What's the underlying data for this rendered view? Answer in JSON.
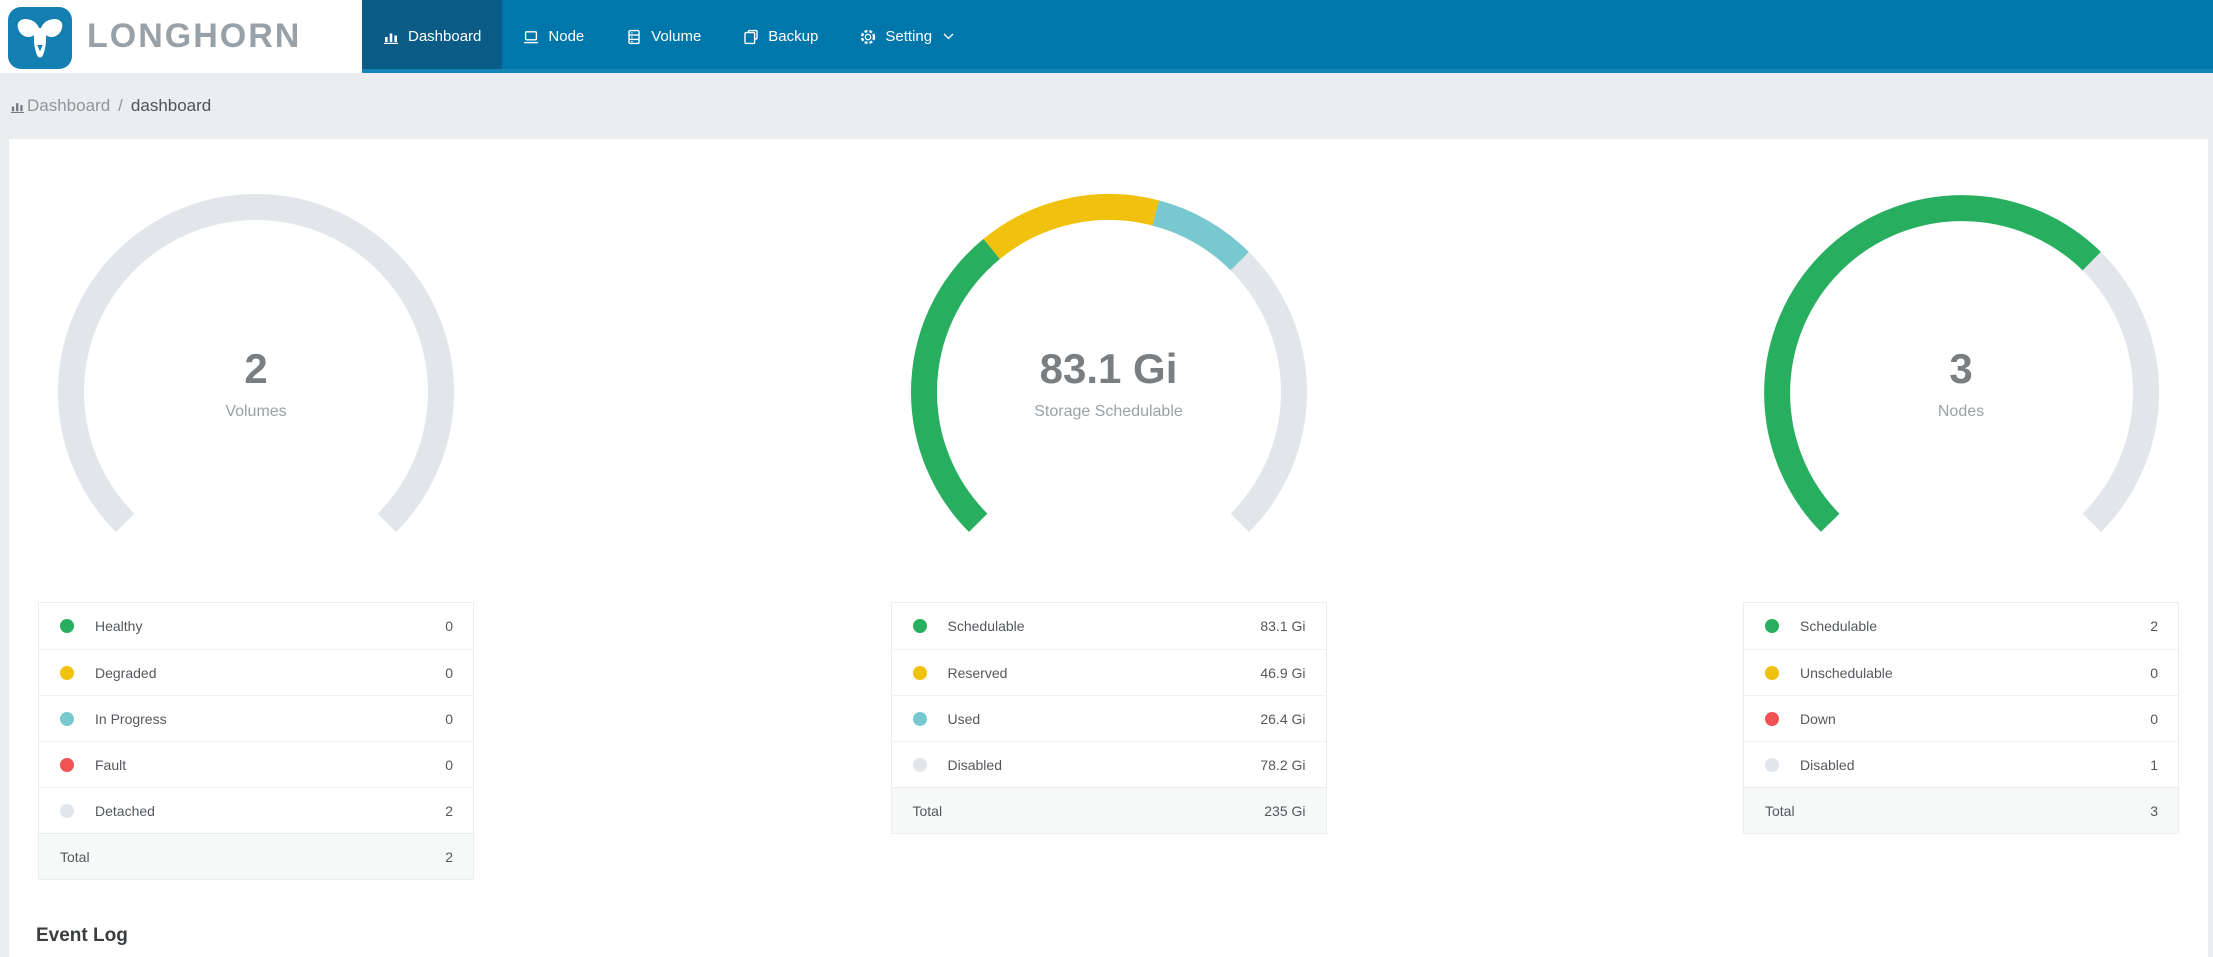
{
  "header": {
    "brand": "LONGHORN",
    "nav": [
      {
        "label": "Dashboard",
        "icon": "bar-chart-icon",
        "active": true
      },
      {
        "label": "Node",
        "icon": "laptop-icon",
        "active": false
      },
      {
        "label": "Volume",
        "icon": "database-icon",
        "active": false
      },
      {
        "label": "Backup",
        "icon": "copy-icon",
        "active": false
      },
      {
        "label": "Setting",
        "icon": "gear-icon",
        "active": false,
        "has_caret": true
      }
    ]
  },
  "breadcrumb": {
    "root": "Dashboard",
    "separator": "/",
    "current": "dashboard"
  },
  "colors": {
    "nav_background": "#0077ab",
    "nav_active": "#0a5c87",
    "nav_underline": "#1585b5",
    "logo_blue": "#1480b2",
    "healthy_green": "#27ae5f",
    "warning_yellow": "#f0c20e",
    "progress_cyan": "#78c9cf",
    "fault_red": "#f05254",
    "disabled_gray": "#e2e5e9"
  },
  "chart_data": [
    {
      "type": "gauge",
      "name": "volumes",
      "center_value": "2",
      "center_label": "Volumes",
      "arc": {
        "start_angle": 225,
        "span": 270
      },
      "segments": [
        {
          "label": "Healthy",
          "value": 0,
          "display": "0",
          "color": "#27ae5f"
        },
        {
          "label": "Degraded",
          "value": 0,
          "display": "0",
          "color": "#f0c20e"
        },
        {
          "label": "In Progress",
          "value": 0,
          "display": "0",
          "color": "#78c9cf"
        },
        {
          "label": "Fault",
          "value": 0,
          "display": "0",
          "color": "#f05254"
        },
        {
          "label": "Detached",
          "value": 2,
          "display": "2",
          "color": "#e2e5e9"
        }
      ],
      "total": {
        "label": "Total",
        "display": "2"
      }
    },
    {
      "type": "gauge",
      "name": "storage-schedulable",
      "center_value": "83.1 Gi",
      "center_label": "Storage Schedulable",
      "arc": {
        "start_angle": 225,
        "span": 270
      },
      "segments": [
        {
          "label": "Schedulable",
          "value": 83.1,
          "display": "83.1 Gi",
          "color": "#27ae5f"
        },
        {
          "label": "Reserved",
          "value": 46.9,
          "display": "46.9 Gi",
          "color": "#f0c20e"
        },
        {
          "label": "Used",
          "value": 26.4,
          "display": "26.4 Gi",
          "color": "#78c9cf"
        },
        {
          "label": "Disabled",
          "value": 78.2,
          "display": "78.2 Gi",
          "color": "#e2e5e9"
        }
      ],
      "total": {
        "label": "Total",
        "display": "235 Gi"
      }
    },
    {
      "type": "gauge",
      "name": "nodes",
      "center_value": "3",
      "center_label": "Nodes",
      "arc": {
        "start_angle": 225,
        "span": 270
      },
      "segments": [
        {
          "label": "Schedulable",
          "value": 2,
          "display": "2",
          "color": "#27ae5f"
        },
        {
          "label": "Unschedulable",
          "value": 0,
          "display": "0",
          "color": "#f0c20e"
        },
        {
          "label": "Down",
          "value": 0,
          "display": "0",
          "color": "#f05254"
        },
        {
          "label": "Disabled",
          "value": 1,
          "display": "1",
          "color": "#e2e5e9"
        }
      ],
      "total": {
        "label": "Total",
        "display": "3"
      }
    }
  ],
  "event_log_title": "Event Log"
}
